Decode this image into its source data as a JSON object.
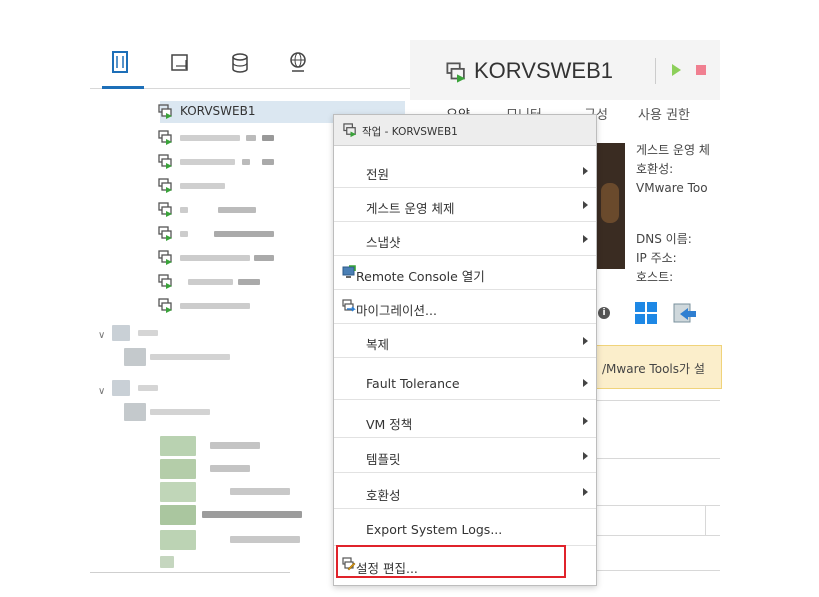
{
  "vm": {
    "name": "KORVSWEB1"
  },
  "tabs": [
    "요약",
    "모니터",
    "구성",
    "사용 권한"
  ],
  "summary": {
    "lines": [
      "게스트 운영 체",
      "호환성:",
      "VMware Too"
    ],
    "lines2": [
      "DNS 이름:",
      "IP 주소:",
      "호스트:"
    ],
    "warning": "/Mware Tools가 설"
  },
  "menu": {
    "header": "작업 - KORVSWEB1",
    "items": [
      {
        "label": "전원",
        "submenu": true,
        "icon": ""
      },
      {
        "label": "게스트 운영 체제",
        "submenu": true,
        "icon": ""
      },
      {
        "label": "스냅샷",
        "submenu": true,
        "icon": ""
      },
      {
        "label": "Remote Console 열기",
        "submenu": false,
        "icon": "remote-console-icon"
      },
      {
        "label": "마이그레이션...",
        "submenu": false,
        "icon": "migrate-icon"
      },
      {
        "label": "복제",
        "submenu": true,
        "icon": ""
      },
      {
        "label": "Fault Tolerance",
        "submenu": true,
        "icon": ""
      },
      {
        "label": "VM 정책",
        "submenu": true,
        "icon": ""
      },
      {
        "label": "템플릿",
        "submenu": true,
        "icon": ""
      },
      {
        "label": "호환성",
        "submenu": true,
        "icon": ""
      },
      {
        "label": "Export System Logs...",
        "submenu": false,
        "icon": ""
      },
      {
        "label": "설정 편집...",
        "submenu": false,
        "icon": "edit-settings-icon"
      }
    ],
    "highlighted_item": "설정 편집..."
  },
  "colors": {
    "accent": "#1d6fb8",
    "highlight_border": "#e0232b",
    "selected_row": "#dbe7f1",
    "warning_bg": "#fbeecb"
  }
}
